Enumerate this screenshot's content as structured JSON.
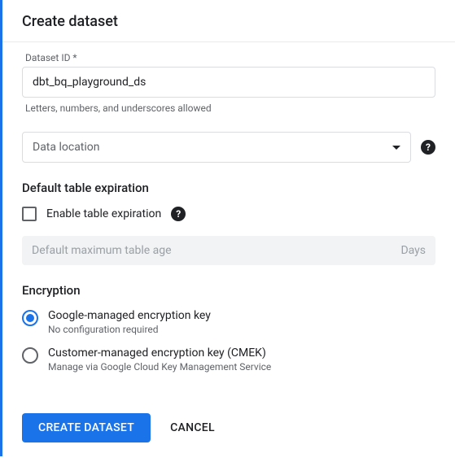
{
  "header": {
    "title": "Create dataset"
  },
  "datasetId": {
    "label": "Dataset ID *",
    "value": "dbt_bq_playground_ds",
    "helper": "Letters, numbers, and underscores allowed"
  },
  "location": {
    "placeholder": "Data location"
  },
  "expiration": {
    "title": "Default table expiration",
    "checkboxLabel": "Enable table expiration",
    "maxAgePlaceholder": "Default maximum table age",
    "unit": "Days"
  },
  "encryption": {
    "title": "Encryption",
    "options": [
      {
        "label": "Google-managed encryption key",
        "helper": "No configuration required"
      },
      {
        "label": "Customer-managed encryption key (CMEK)",
        "helper": "Manage via Google Cloud Key Management Service"
      }
    ]
  },
  "actions": {
    "create": "CREATE DATASET",
    "cancel": "CANCEL"
  }
}
